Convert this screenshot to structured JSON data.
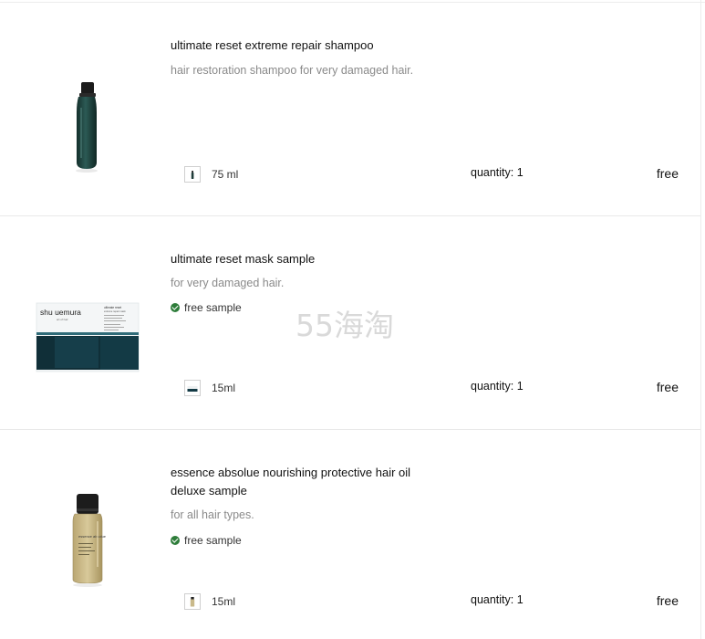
{
  "items": [
    {
      "name": "ultimate reset extreme repair shampoo",
      "description": "hair restoration shampoo for very damaged hair.",
      "badge": "",
      "size": "75 ml",
      "quantity": "quantity: 1",
      "price": "free",
      "image": "dark-green-shampoo-bottle",
      "swatch_icon": "bottle-thumbnail-icon"
    },
    {
      "name": "ultimate reset mask sample",
      "description": "for very damaged hair.",
      "badge": "free sample",
      "size": "15ml",
      "quantity": "quantity: 1",
      "price": "free",
      "image": "mask-sachet",
      "image_text": {
        "brand": "shu uemura",
        "brand_sub": "art of hair",
        "product": "ultimate reset",
        "product_sub": "extreme repair mask"
      },
      "swatch_icon": "sachet-thumbnail-icon"
    },
    {
      "name": "essence absolue nourishing protective hair oil deluxe sample",
      "description": "for all hair types.",
      "badge": "free sample",
      "size": "15ml",
      "quantity": "quantity: 1",
      "price": "free",
      "image": "golden-oil-bottle",
      "image_text": {
        "product": "essence absolue"
      },
      "swatch_icon": "oil-bottle-thumbnail-icon"
    }
  ],
  "watermark": "55海淘",
  "colors": {
    "check_green": "#2e7d3a",
    "shampoo_bottle": "#1f3d3a",
    "mask_teal": "#133a45",
    "oil_gold": "#c9b98a"
  }
}
